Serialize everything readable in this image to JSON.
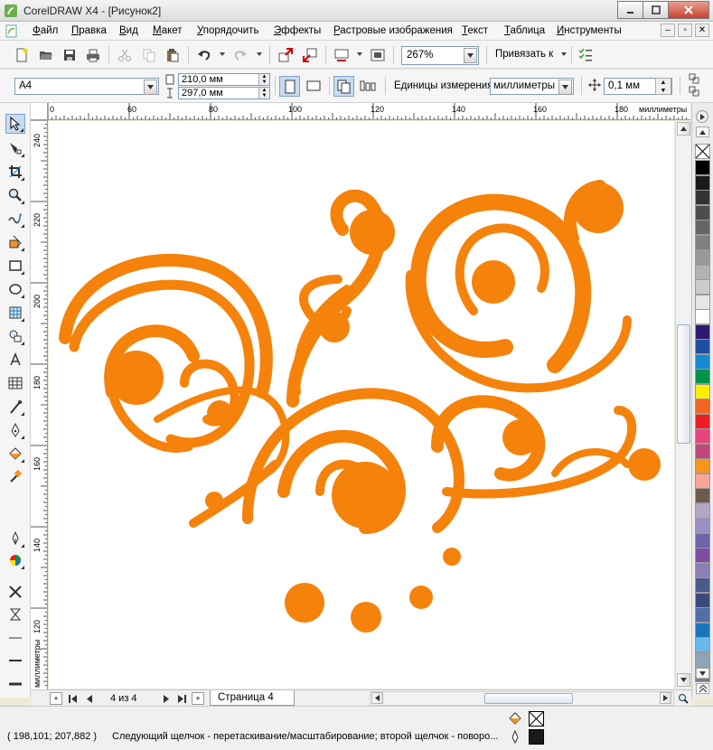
{
  "window": {
    "title": "CorelDRAW X4 - [Рисунок2]",
    "buttons": [
      "minimize-button",
      "maximize-button",
      "close-button"
    ]
  },
  "menu": {
    "items": [
      "Файл",
      "Правка",
      "Вид",
      "Макет",
      "Упорядочить",
      "Эффекты",
      "Растровые изображения",
      "Текст",
      "Таблица",
      "Инструменты"
    ]
  },
  "toolbar": {
    "zoom_value": "267%",
    "snap_label": "Привязать к"
  },
  "property_bar": {
    "page_size": "A4",
    "width": "210,0 мм",
    "height": "297,0 мм",
    "units_label": "Единицы измерения:",
    "units_value": "миллиметры",
    "nudge_value": "0,1 мм"
  },
  "rulers": {
    "h_labels": [
      "0",
      "60",
      "80",
      "100",
      "120",
      "140",
      "160",
      "180",
      "миллиметры"
    ],
    "v_labels": [
      "240",
      "220",
      "200",
      "180",
      "160",
      "140",
      "120",
      "миллиметры"
    ]
  },
  "page_nav": {
    "count": "4 из 4",
    "tab_label": "Страница 4"
  },
  "status": {
    "coords": "( 198,101; 207,882 )",
    "hint": "Следующий щелчок - перетаскивание/масштабирование; второй щелчок - поворо..."
  },
  "colors": {
    "artwork": "#f5820a",
    "accent": "#7da2ce"
  },
  "palette": [
    "#ffffff",
    "#000000",
    "#1a1a1a",
    "#333333",
    "#4d4d4d",
    "#666666",
    "#808080",
    "#999999",
    "#b3b3b3",
    "#cccccc",
    "#e6e6e6",
    "#ffffff",
    "#2e1a6e",
    "#1e4fa0",
    "#1589d2",
    "#00934a",
    "#ffee00",
    "#f26522",
    "#ed1c24",
    "#e8457c",
    "#c1467a",
    "#f7941d",
    "#f9a59a",
    "#6d5a4a",
    "#b3a7c9",
    "#9c8fc4",
    "#6f62a8",
    "#7c4da0",
    "#8b7fb3",
    "#4b5a8c",
    "#3a4a7a",
    "#4f6fa8",
    "#1b75bb",
    "#6ab8ea",
    "#8fa3b8",
    "#6e7f91"
  ]
}
